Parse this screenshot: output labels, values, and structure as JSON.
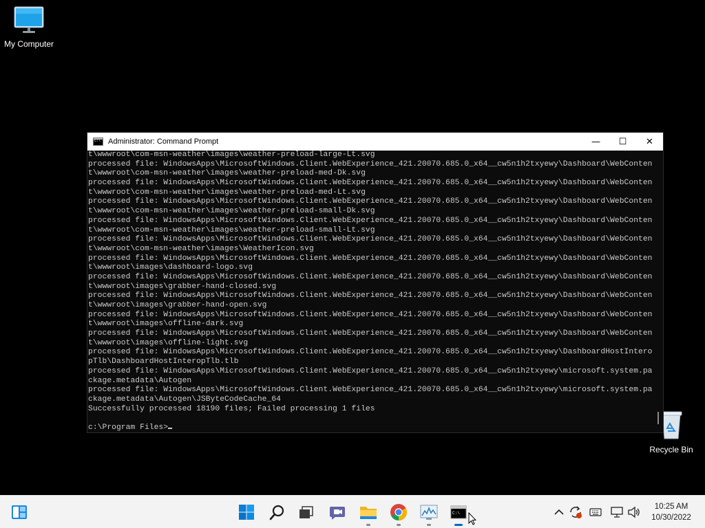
{
  "desktop": {
    "icons": [
      {
        "label": "My Computer",
        "icon": "monitor-icon"
      },
      {
        "label": "Recycle Bin",
        "icon": "recycle-bin-icon"
      }
    ]
  },
  "window": {
    "title": "Administrator: Command Prompt",
    "minimize": "—",
    "maximize": "☐",
    "close": "✕"
  },
  "console": {
    "lines": [
      "t\\wwwroot\\com-msn-weather\\images\\weather-preload-large-Lt.svg",
      "processed file: WindowsApps\\MicrosoftWindows.Client.WebExperience_421.20070.685.0_x64__cw5n1h2txyewy\\Dashboard\\WebConten",
      "t\\wwwroot\\com-msn-weather\\images\\weather-preload-med-Dk.svg",
      "processed file: WindowsApps\\MicrosoftWindows.Client.WebExperience_421.20070.685.0_x64__cw5n1h2txyewy\\Dashboard\\WebConten",
      "t\\wwwroot\\com-msn-weather\\images\\weather-preload-med-Lt.svg",
      "processed file: WindowsApps\\MicrosoftWindows.Client.WebExperience_421.20070.685.0_x64__cw5n1h2txyewy\\Dashboard\\WebConten",
      "t\\wwwroot\\com-msn-weather\\images\\weather-preload-small-Dk.svg",
      "processed file: WindowsApps\\MicrosoftWindows.Client.WebExperience_421.20070.685.0_x64__cw5n1h2txyewy\\Dashboard\\WebConten",
      "t\\wwwroot\\com-msn-weather\\images\\weather-preload-small-Lt.svg",
      "processed file: WindowsApps\\MicrosoftWindows.Client.WebExperience_421.20070.685.0_x64__cw5n1h2txyewy\\Dashboard\\WebConten",
      "t\\wwwroot\\com-msn-weather\\images\\WeatherIcon.svg",
      "processed file: WindowsApps\\MicrosoftWindows.Client.WebExperience_421.20070.685.0_x64__cw5n1h2txyewy\\Dashboard\\WebConten",
      "t\\wwwroot\\images\\dashboard-logo.svg",
      "processed file: WindowsApps\\MicrosoftWindows.Client.WebExperience_421.20070.685.0_x64__cw5n1h2txyewy\\Dashboard\\WebConten",
      "t\\wwwroot\\images\\grabber-hand-closed.svg",
      "processed file: WindowsApps\\MicrosoftWindows.Client.WebExperience_421.20070.685.0_x64__cw5n1h2txyewy\\Dashboard\\WebConten",
      "t\\wwwroot\\images\\grabber-hand-open.svg",
      "processed file: WindowsApps\\MicrosoftWindows.Client.WebExperience_421.20070.685.0_x64__cw5n1h2txyewy\\Dashboard\\WebConten",
      "t\\wwwroot\\images\\offline-dark.svg",
      "processed file: WindowsApps\\MicrosoftWindows.Client.WebExperience_421.20070.685.0_x64__cw5n1h2txyewy\\Dashboard\\WebConten",
      "t\\wwwroot\\images\\offline-light.svg",
      "processed file: WindowsApps\\MicrosoftWindows.Client.WebExperience_421.20070.685.0_x64__cw5n1h2txyewy\\DashboardHostIntero",
      "pTlb\\DashboardHostInteropTlb.tlb",
      "processed file: WindowsApps\\MicrosoftWindows.Client.WebExperience_421.20070.685.0_x64__cw5n1h2txyewy\\microsoft.system.pa",
      "ckage.metadata\\Autogen",
      "processed file: WindowsApps\\MicrosoftWindows.Client.WebExperience_421.20070.685.0_x64__cw5n1h2txyewy\\microsoft.system.pa",
      "ckage.metadata\\Autogen\\JSByteCodeCache_64",
      "Successfully processed 18190 files; Failed processing 1 files",
      ""
    ],
    "prompt": "c:\\Program Files>"
  },
  "taskbar": {
    "widgets_icon": "widgets-icon",
    "apps": [
      {
        "name": "start",
        "icon": "windows-start-icon",
        "running": false
      },
      {
        "name": "search",
        "icon": "search-icon",
        "running": false
      },
      {
        "name": "task-view",
        "icon": "task-view-icon",
        "running": false
      },
      {
        "name": "chat",
        "icon": "teams-chat-icon",
        "running": false
      },
      {
        "name": "file-explorer",
        "icon": "folder-icon",
        "running": true
      },
      {
        "name": "chrome",
        "icon": "chrome-icon",
        "running": true
      },
      {
        "name": "resource-monitor",
        "icon": "performance-monitor-icon",
        "running": true
      },
      {
        "name": "command-prompt",
        "icon": "terminal-icon",
        "running": true,
        "active": true
      }
    ],
    "tray": {
      "icons": [
        "chevron-up-icon",
        "sync-alert-icon",
        "keyboard-icon",
        "network-icon",
        "volume-icon"
      ],
      "time": "10:25 AM",
      "date": "10/30/2022"
    }
  },
  "colors": {
    "console_bg": "#0c0c0c",
    "console_fg": "#cccccc",
    "taskbar_bg": "#f3f3f3",
    "accent": "#0067c0"
  }
}
